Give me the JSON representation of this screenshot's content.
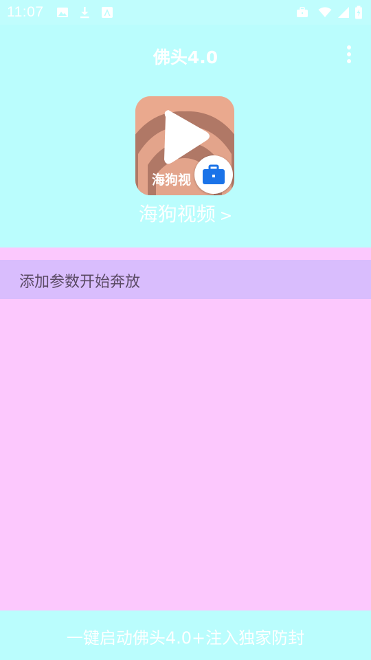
{
  "status_bar": {
    "time": "11:07",
    "icons": [
      "image-icon",
      "download-icon",
      "font-a-icon",
      "briefcase-icon",
      "wifi-icon",
      "signal-icon",
      "battery-icon"
    ]
  },
  "app_bar": {
    "title": "佛头4.0",
    "menu_icon": "more-vert-icon"
  },
  "target_app": {
    "icon_text": "海狗视",
    "name": "海狗视频",
    "chevron": ">",
    "badge_icon": "work-briefcase-icon"
  },
  "content": {
    "param_row_label": "添加参数开始奔放"
  },
  "bottom_bar": {
    "label": "一键启动佛头4.0+注入独家防封"
  },
  "colors": {
    "header_bg": "#bafdfd",
    "content_bg": "#fcc8fd",
    "row_bg": "#d9bdfd",
    "text_white": "#ffffff",
    "row_text": "#5a4a64",
    "badge_blue": "#1a73e8",
    "icon_orange": "#eaa98e"
  }
}
